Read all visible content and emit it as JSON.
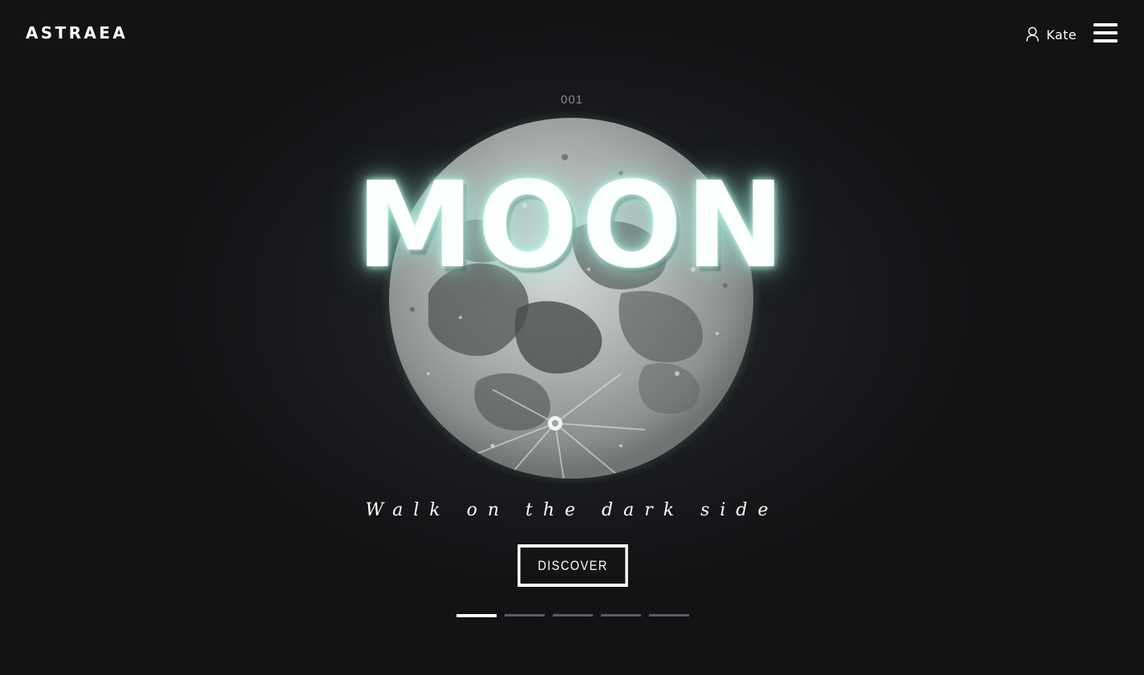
{
  "header": {
    "logo": "ASTRAEA",
    "user_name": "Kate",
    "user_icon": "user-icon",
    "menu_icon": "hamburger-menu-icon"
  },
  "hero": {
    "slide_number": "001",
    "title": "MOON",
    "tagline": "Walk on the dark side",
    "cta_label": "DISCOVER"
  },
  "pager": {
    "total": 5,
    "active_index": 0
  },
  "colors": {
    "background": "#121315",
    "text": "#ffffff",
    "glow": "#b4f0e1",
    "pager_inactive": "#5b5d61",
    "slide_number": "#8a8c90"
  }
}
